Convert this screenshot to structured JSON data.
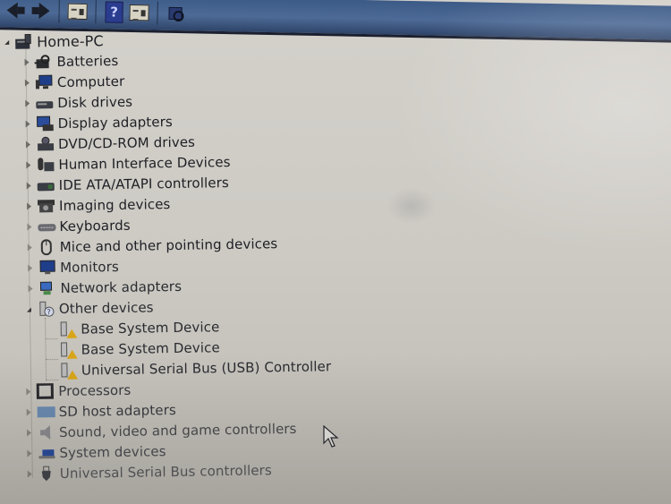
{
  "toolbar": {
    "buttons": [
      {
        "name": "back-button",
        "icon": "arrow-left-icon"
      },
      {
        "name": "forward-button",
        "icon": "arrow-right-icon"
      },
      {
        "name": "show-hide-console-tree-button",
        "icon": "console-tree-icon"
      },
      {
        "name": "help-button",
        "icon": "help-icon",
        "glyph": "?"
      },
      {
        "name": "properties-button",
        "icon": "properties-icon"
      },
      {
        "name": "scan-for-hardware-changes-button",
        "icon": "scan-hardware-icon"
      }
    ]
  },
  "tree": {
    "root": {
      "label": "Home-PC",
      "icon": "computer-icon",
      "expanded": true
    },
    "categories": [
      {
        "label": "Batteries",
        "icon": "battery-icon",
        "expanded": false
      },
      {
        "label": "Computer",
        "icon": "computer-icon",
        "expanded": false
      },
      {
        "label": "Disk drives",
        "icon": "disk-drive-icon",
        "expanded": false
      },
      {
        "label": "Display adapters",
        "icon": "display-adapter-icon",
        "expanded": false
      },
      {
        "label": "DVD/CD-ROM drives",
        "icon": "dvd-drive-icon",
        "expanded": false
      },
      {
        "label": "Human Interface Devices",
        "icon": "hid-icon",
        "expanded": false
      },
      {
        "label": "IDE ATA/ATAPI controllers",
        "icon": "ide-controller-icon",
        "expanded": false
      },
      {
        "label": "Imaging devices",
        "icon": "camera-icon",
        "expanded": false
      },
      {
        "label": "Keyboards",
        "icon": "keyboard-icon",
        "expanded": false
      },
      {
        "label": "Mice and other pointing devices",
        "icon": "mouse-icon",
        "expanded": false
      },
      {
        "label": "Monitors",
        "icon": "monitor-icon",
        "expanded": false
      },
      {
        "label": "Network adapters",
        "icon": "network-adapter-icon",
        "expanded": false
      },
      {
        "label": "Other devices",
        "icon": "unknown-device-icon",
        "expanded": true,
        "children": [
          {
            "label": "Base System Device",
            "icon": "warning-device-icon",
            "status": "warning"
          },
          {
            "label": "Base System Device",
            "icon": "warning-device-icon",
            "status": "warning"
          },
          {
            "label": "Universal Serial Bus (USB) Controller",
            "icon": "warning-device-icon",
            "status": "warning"
          }
        ]
      },
      {
        "label": "Processors",
        "icon": "processor-icon",
        "expanded": false
      },
      {
        "label": "SD host adapters",
        "icon": "sd-host-icon",
        "expanded": false
      },
      {
        "label": "Sound, video and game controllers",
        "icon": "speaker-icon",
        "expanded": false
      },
      {
        "label": "System devices",
        "icon": "system-device-icon",
        "expanded": false
      },
      {
        "label": "Universal Serial Bus controllers",
        "icon": "usb-icon",
        "expanded": false
      }
    ]
  },
  "colors": {
    "toolbar": "#4d6a96",
    "background": "#cdcac4",
    "text": "#1e1f24",
    "warning": "#d8a518"
  }
}
